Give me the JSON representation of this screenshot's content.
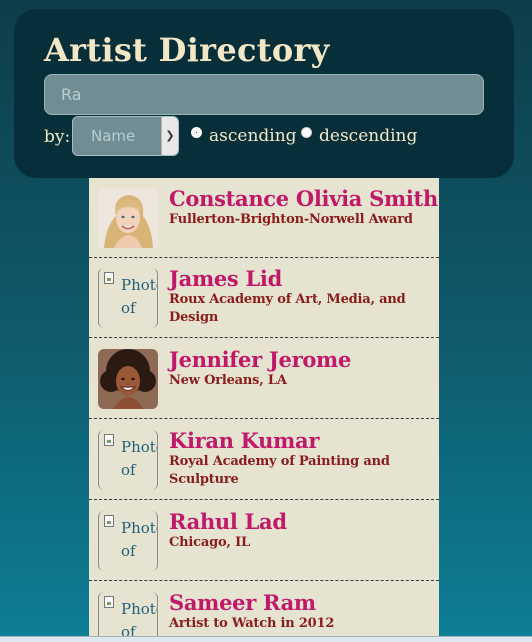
{
  "header": {
    "title": "Artist Directory",
    "search_value": "Ra",
    "sort_by_label": "by:",
    "sort_select_value": "Name",
    "order_options": [
      {
        "label": "ascending",
        "checked": true
      },
      {
        "label": "descending",
        "checked": false
      }
    ]
  },
  "artists": [
    {
      "name": "Constance Olivia Smith",
      "description": "Fullerton-Brighton-Norwell Award",
      "photo": "portrait-blonde"
    },
    {
      "name": "James Lid",
      "description": "Roux Academy of Art, Media, and Design",
      "photo": "broken",
      "photo_alt": "Photo of"
    },
    {
      "name": "Jennifer Jerome",
      "description": "New Orleans, LA",
      "photo": "portrait-curly"
    },
    {
      "name": "Kiran Kumar",
      "description": "Royal Academy of Painting and Sculpture",
      "photo": "broken",
      "photo_alt": "Photo of"
    },
    {
      "name": "Rahul Lad",
      "description": "Chicago, IL",
      "photo": "broken",
      "photo_alt": "Photo of"
    },
    {
      "name": "Sameer Ram",
      "description": "Artist to Watch in 2012",
      "photo": "broken",
      "photo_alt": "Photo of"
    }
  ],
  "colors": {
    "title": "#f3e7c6",
    "name": "#c2186a",
    "description": "#8a1c1c",
    "list_background": "#e6e3d0"
  }
}
